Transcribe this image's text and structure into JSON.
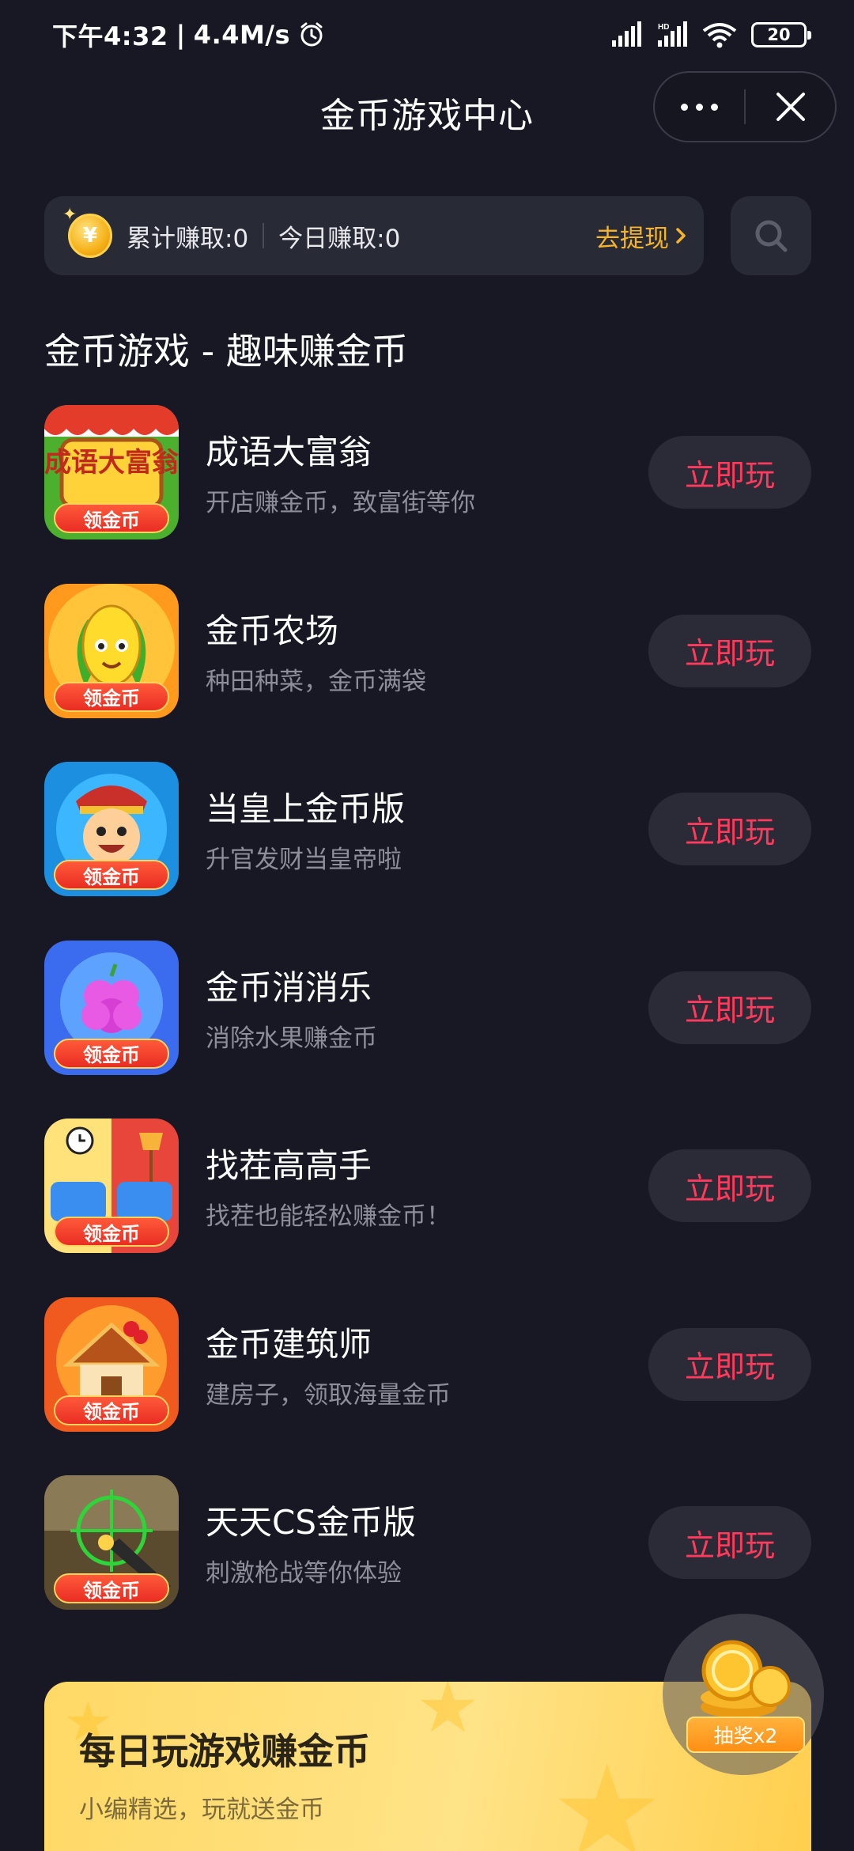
{
  "status_bar": {
    "time": "下午4:32",
    "network_speed": "4.4M/s",
    "separator": "|",
    "hd_label": "HD",
    "battery": "20"
  },
  "header": {
    "title": "金币游戏中心",
    "more_icon": "more-dots-icon",
    "close_icon": "close-icon"
  },
  "earnings": {
    "total_label": "累计赚取:0",
    "today_label": "今日赚取:0",
    "withdraw_label": "去提现",
    "coin_symbol": "¥",
    "accent_color": "#f6b428"
  },
  "section": {
    "title": "金币游戏 - 趣味赚金币"
  },
  "games": [
    {
      "name": "成语大富翁",
      "desc": "开店赚金币，致富街等你",
      "play": "立即玩",
      "badge": "领金币",
      "icon_art": "成语大富翁"
    },
    {
      "name": "金币农场",
      "desc": "种田种菜，金币满袋",
      "play": "立即玩",
      "badge": "领金币",
      "icon_art": ""
    },
    {
      "name": "当皇上金币版",
      "desc": "升官发财当皇帝啦",
      "play": "立即玩",
      "badge": "领金币",
      "icon_art": ""
    },
    {
      "name": "金币消消乐",
      "desc": "消除水果赚金币",
      "play": "立即玩",
      "badge": "领金币",
      "icon_art": ""
    },
    {
      "name": "找茬高高手",
      "desc": "找茬也能轻松赚金币！",
      "play": "立即玩",
      "badge": "领金币",
      "icon_art": ""
    },
    {
      "name": "金币建筑师",
      "desc": "建房子，领取海量金币",
      "play": "立即玩",
      "badge": "领金币",
      "icon_art": ""
    },
    {
      "name": "天天CS金币版",
      "desc": "刺激枪战等你体验",
      "play": "立即玩",
      "badge": "领金币",
      "icon_art": ""
    }
  ],
  "banner": {
    "title": "每日玩游戏赚金币",
    "subtitle": "小编精选，玩就送金币"
  },
  "lottery": {
    "label": "抽奖x2"
  },
  "colors": {
    "background": "#171823",
    "play_text": "#ff3a5c",
    "card": "#282a36"
  }
}
